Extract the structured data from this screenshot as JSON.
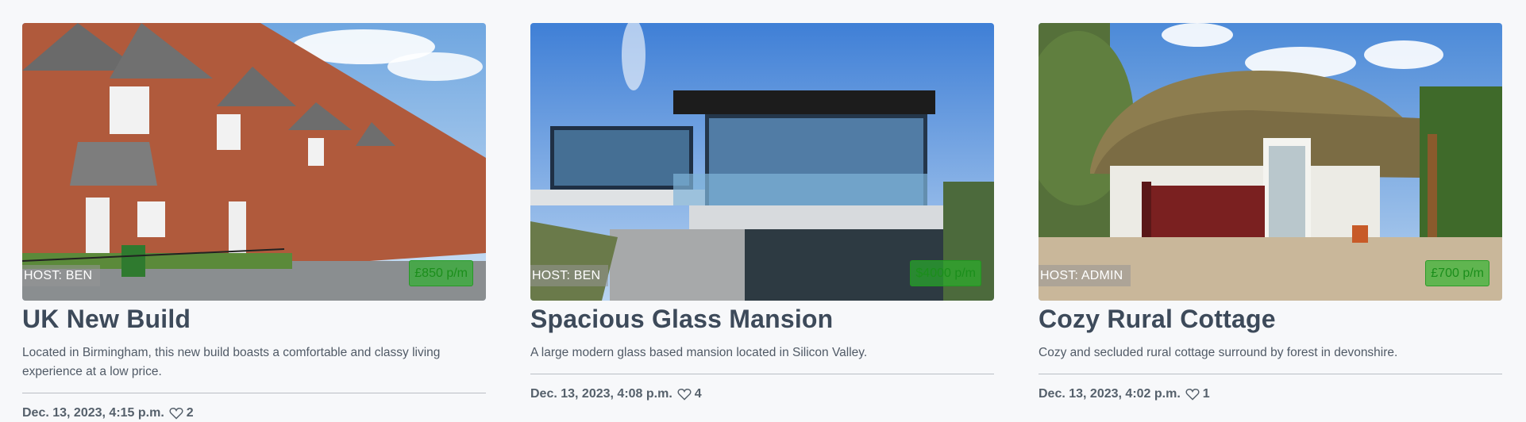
{
  "listings": [
    {
      "host": "HOST: BEN",
      "price": "£850 p/m",
      "title": "UK New Build",
      "description": "Located in Birmingham, this new build boasts a comfortable and classy living experience at a low price.",
      "date": "Dec. 13, 2023, 4:15 p.m.",
      "likes": "2",
      "image_icon": "terraced-houses-photo"
    },
    {
      "host": "HOST: BEN",
      "price": "$4000 p/m",
      "title": "Spacious Glass Mansion",
      "description": "A large modern glass based mansion located in Silicon Valley.",
      "date": "Dec. 13, 2023, 4:08 p.m.",
      "likes": "4",
      "image_icon": "glass-mansion-photo"
    },
    {
      "host": "HOST: ADMIN",
      "price": "£700 p/m",
      "title": "Cozy Rural Cottage",
      "description": "Cozy and secluded rural cottage surround by forest in devonshire.",
      "date": "Dec. 13, 2023, 4:02 p.m.",
      "likes": "1",
      "image_icon": "thatched-cottage-photo"
    }
  ],
  "colors": {
    "price_badge": "#28b428",
    "background": "#f7f8fa",
    "title": "#3d4a5a"
  }
}
